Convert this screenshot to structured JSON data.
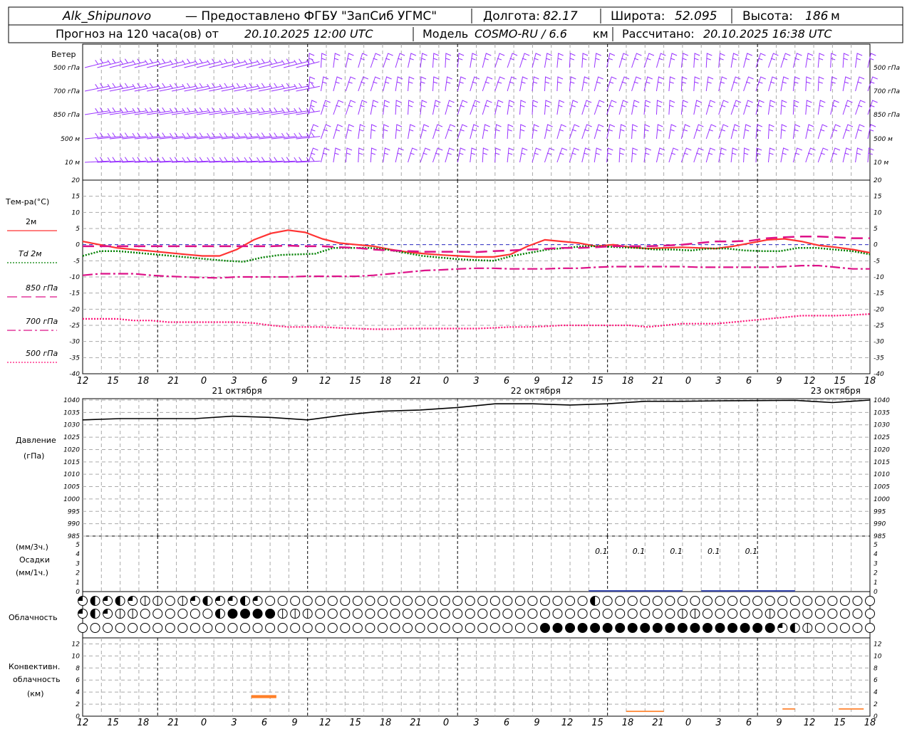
{
  "header": {
    "station": "Alk_Shipunovo",
    "provider": "— Предоставлено ФГБУ \"ЗапСиб УГМС\"",
    "lon_label": "Долгота:",
    "lon_value": "82.17",
    "lat_label": "Широта:",
    "lat_value": "52.095",
    "alt_label": "Высота:",
    "alt_value": "186",
    "alt_unit": "м",
    "forecast_prefix": "Прогноз на 120 часа(ов) от",
    "forecast_start": "20.10.2025 12:00 UTC",
    "model_label": "Модель",
    "model_name": "COSMO-RU / 6.6",
    "model_unit": "км",
    "computed_label": "Рассчитано:",
    "computed_value": "20.10.2025 16:38 UTC"
  },
  "wind_panel": {
    "title": "Ветер",
    "levels": [
      "500 гПа",
      "700 гПа",
      "850 гПа",
      "500 м",
      "10 м"
    ],
    "color": "#9933ff"
  },
  "temperature_panel": {
    "title": "Тем-ра(°C)",
    "legend": [
      {
        "label": "2м",
        "color": "#ff3333",
        "style": "solid"
      },
      {
        "label": "Td  2м",
        "color": "#008000",
        "style": "dotted"
      },
      {
        "label": "850 гПа",
        "color": "#dd1188",
        "style": "dashed"
      },
      {
        "label": "700 гПа",
        "color": "#dd1188",
        "style": "dashdot"
      },
      {
        "label": "500 гПа",
        "color": "#ff1177",
        "style": "fine-dotted"
      }
    ]
  },
  "pressure_panel": {
    "title": "Давление",
    "unit": "(гПа)"
  },
  "precip_panel": {
    "unit_top": "(мм/3ч.)",
    "title": "Осадки",
    "unit_bottom": "(мм/1ч.)",
    "value_labels": [
      "0.1",
      "0.1",
      "0.1",
      "0.1",
      "0.1"
    ]
  },
  "cloud_panel": {
    "title": "Облачность"
  },
  "convective_panel": {
    "title_line1": "Конвективн.",
    "title_line2": "облачность",
    "unit": "(км)"
  },
  "x_axis": {
    "tick_labels": [
      "12",
      "15",
      "18",
      "21",
      "0",
      "3",
      "6",
      "9",
      "12",
      "15",
      "18",
      "21",
      "0",
      "3",
      "6",
      "9",
      "12",
      "15",
      "18",
      "21",
      "0",
      "3",
      "6",
      "9",
      "12",
      "15",
      "18"
    ],
    "dates": [
      "21 октября",
      "22 октября",
      "23 октября"
    ]
  },
  "chart_data": [
    {
      "type": "line",
      "name": "temperature",
      "x_hours": [
        0,
        3,
        6,
        9,
        12,
        15,
        18,
        21,
        24,
        27,
        30,
        33,
        36,
        39,
        42,
        45,
        48,
        51,
        54,
        57,
        60,
        63,
        66,
        69,
        72,
        75,
        78,
        81,
        84,
        87,
        90,
        93,
        96,
        99,
        102,
        105,
        108,
        111,
        114,
        117,
        120,
        123,
        126
      ],
      "ylim": [
        -40,
        20
      ],
      "yticks": [
        20,
        15,
        10,
        5,
        0,
        -5,
        -10,
        -15,
        -20,
        -25,
        -30,
        -35,
        -40
      ],
      "series": [
        {
          "name": "2м",
          "values": [
            1,
            0,
            -1,
            -1.5,
            -2,
            -2.5,
            -3,
            -3.5,
            -3.5,
            -1.5,
            1.5,
            3.5,
            4.5,
            3.8,
            1.8,
            0.5,
            0,
            -0.5,
            -1.5,
            -2.3,
            -2.8,
            -3.2,
            -3.5,
            -3.8,
            -3.8,
            -3,
            -0.5,
            1.5,
            1,
            0.5,
            -0.5,
            0,
            -0.8,
            -1.2,
            -1,
            -0.8,
            -1,
            -1.2,
            -0.5,
            0.5,
            1.5,
            1.8,
            1,
            -0.2,
            -0.8,
            -1.5,
            -2.5
          ]
        },
        {
          "name": "Td 2м",
          "values": [
            -3.5,
            -2,
            -2,
            -2.5,
            -3,
            -3.5,
            -4,
            -4.5,
            -5,
            -5.3,
            -4,
            -3.2,
            -3,
            -2.8,
            -1,
            -1,
            -1,
            -1.5,
            -2.5,
            -3.5,
            -4,
            -4.5,
            -4.8,
            -5,
            -3.5,
            -2.5,
            -1.5,
            -1,
            -0.5,
            -0.5,
            -0.8,
            -1,
            -1.5,
            -1.5,
            -1.8,
            -1.2,
            -1.2,
            -1.8,
            -2,
            -2,
            -1,
            -1,
            -1.5,
            -2,
            -3
          ]
        },
        {
          "name": "850 гПа",
          "values": [
            -0.5,
            -0.5,
            -0.5,
            -0.5,
            -0.5,
            -0.5,
            -0.5,
            -0.5,
            -0.5,
            -0.5,
            -0.5,
            -0.5,
            -0.3,
            -0.5,
            -0.5,
            -0.8,
            -1,
            -1.5,
            -1.8,
            -2,
            -2.2,
            -2.2,
            -2.2,
            -2.3,
            -2,
            -1.8,
            -1.5,
            -1.3,
            -1,
            -1,
            -0.8,
            -0.5,
            -0.5,
            -0.5,
            -0.3,
            0,
            0.5,
            1,
            1,
            1.2,
            2,
            2.3,
            2.5,
            2.5,
            2.3,
            2,
            2
          ]
        },
        {
          "name": "700 гПа",
          "values": [
            -9.5,
            -9,
            -9,
            -9,
            -9.5,
            -9.8,
            -10,
            -10.2,
            -10.3,
            -10,
            -10,
            -10,
            -10,
            -9.8,
            -9.8,
            -9.8,
            -9.8,
            -9.5,
            -9,
            -8.5,
            -8,
            -7.8,
            -7.5,
            -7.3,
            -7.3,
            -7.5,
            -7.5,
            -7.5,
            -7.3,
            -7.3,
            -7,
            -6.8,
            -6.8,
            -6.8,
            -6.8,
            -6.8,
            -7,
            -7,
            -7,
            -7,
            -7,
            -6.8,
            -6.5,
            -6.5,
            -7,
            -7.5,
            -7.5
          ]
        },
        {
          "name": "500 гПа",
          "values": [
            -23,
            -23,
            -23,
            -23.5,
            -23.5,
            -24,
            -24,
            -24,
            -24,
            -24,
            -24.3,
            -25,
            -25.5,
            -25.5,
            -25.5,
            -25.8,
            -26,
            -26.2,
            -26.2,
            -26,
            -26,
            -26,
            -26,
            -26,
            -25.8,
            -25.5,
            -25.5,
            -25.3,
            -25,
            -25,
            -25,
            -25,
            -25,
            -25.5,
            -25,
            -24.5,
            -24.5,
            -24.5,
            -24,
            -23.5,
            -23,
            -22.5,
            -22,
            -22,
            -22,
            -21.8,
            -21.5
          ]
        }
      ]
    },
    {
      "type": "line",
      "name": "pressure",
      "x_hours": [
        0,
        6,
        12,
        18,
        24,
        30,
        36,
        42,
        48,
        54,
        60,
        66,
        72,
        78,
        84,
        90,
        96,
        102,
        108,
        114,
        120,
        123,
        126
      ],
      "ylim": [
        985,
        1040
      ],
      "yticks": [
        1040,
        1035,
        1030,
        1025,
        1020,
        1015,
        1010,
        1005,
        1000,
        995,
        990,
        985
      ],
      "values": [
        1032,
        1032.5,
        1032.5,
        1032.5,
        1033.5,
        1033,
        1032,
        1034,
        1035.5,
        1036,
        1037,
        1038.5,
        1038.5,
        1038,
        1038.5,
        1039.5,
        1039.5,
        1039.7,
        1039.8,
        1039.9,
        1039,
        1039.5,
        1040
      ]
    },
    {
      "type": "bar",
      "name": "precipitation",
      "ylim": [
        0,
        5
      ],
      "yticks": [
        5,
        4,
        3,
        2,
        1,
        0
      ],
      "bars_hours": [
        [
          81,
          96,
          0.05
        ],
        [
          99,
          114,
          0.05
        ]
      ],
      "labels_hours": [
        83,
        89,
        95,
        101,
        107
      ]
    },
    {
      "type": "bar",
      "name": "convective_cloud",
      "ylim": [
        0,
        13
      ],
      "yticks": [
        12,
        10,
        8,
        6,
        4,
        2,
        0
      ],
      "segments": [
        {
          "from": 27,
          "to": 31,
          "base": 3,
          "top": 3.5
        },
        {
          "from": 87,
          "to": 93,
          "base": 0.7,
          "top": 0.9
        },
        {
          "from": 112,
          "to": 114,
          "base": 1.1,
          "top": 1.3
        },
        {
          "from": 121,
          "to": 125,
          "base": 1.1,
          "top": 1.3
        }
      ]
    }
  ]
}
